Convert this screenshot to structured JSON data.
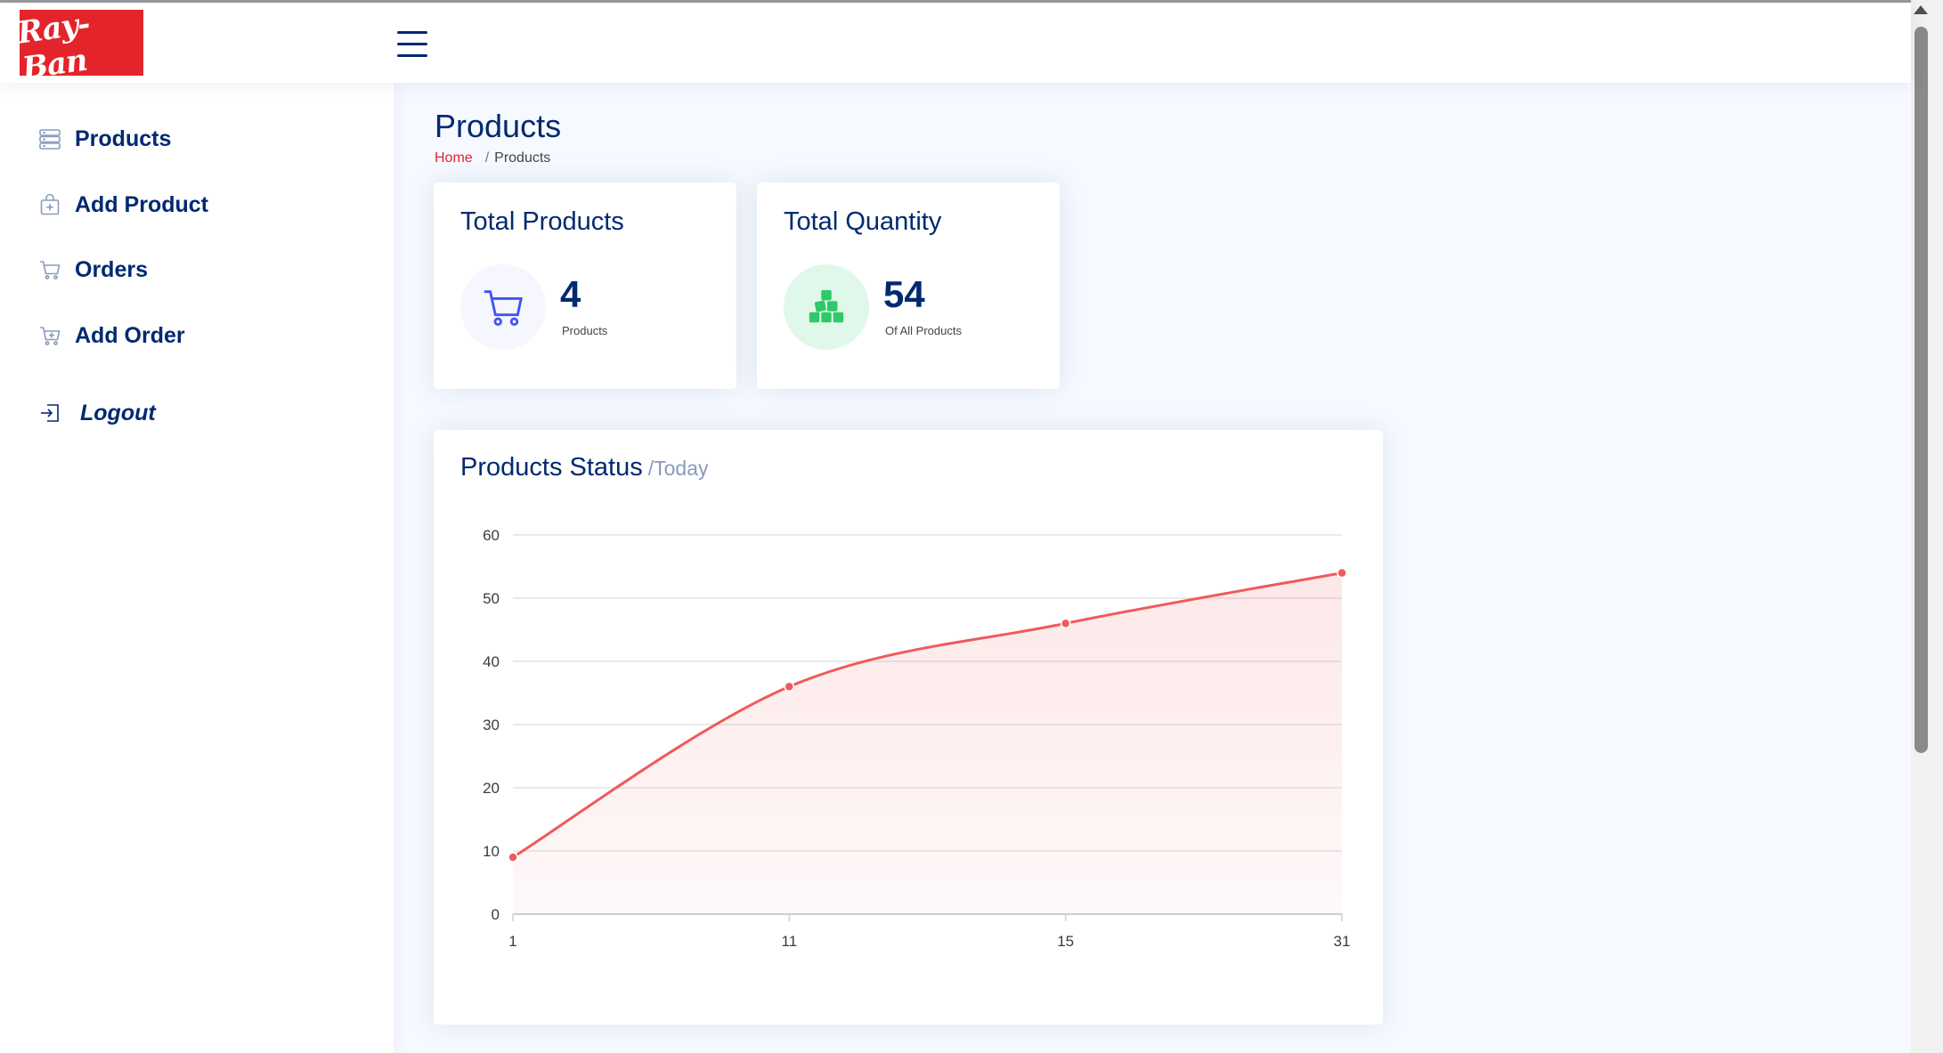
{
  "header": {
    "logo_text": "Ray-Ban",
    "menu_icon": "hamburger-icon"
  },
  "sidebar": {
    "items": [
      {
        "label": "Products",
        "icon": "products-list-icon"
      },
      {
        "label": "Add Product",
        "icon": "add-bag-icon"
      },
      {
        "label": "Orders",
        "icon": "cart-icon"
      },
      {
        "label": "Add Order",
        "icon": "add-cart-icon"
      },
      {
        "label": "Logout",
        "icon": "logout-icon"
      }
    ]
  },
  "page": {
    "title": "Products",
    "breadcrumb": {
      "home": "Home",
      "separator": "/",
      "current": "Products"
    }
  },
  "cards": {
    "total_products": {
      "title": "Total Products",
      "value": "4",
      "label": "Products",
      "icon": "cart-icon"
    },
    "total_quantity": {
      "title": "Total Quantity",
      "value": "54",
      "label": "Of All Products",
      "icon": "boxes-icon"
    }
  },
  "chart": {
    "title": "Products Status",
    "subtitle": "/Today"
  },
  "colors": {
    "accent": "#e3242b",
    "navy": "#012970",
    "line": "#f05a5a",
    "cart_bg": "#f6f6fe",
    "cart_icon": "#4154f1",
    "boxes_bg": "#e0f8e9",
    "boxes_icon": "#2eca6a"
  },
  "chart_data": {
    "type": "area",
    "title": "",
    "xlabel": "",
    "ylabel": "",
    "x": [
      "1",
      "11",
      "15",
      "31"
    ],
    "series": [
      {
        "values": [
          9,
          36,
          46,
          54
        ]
      }
    ],
    "ylim": [
      0,
      60
    ],
    "yticks": [
      0,
      10,
      20,
      30,
      40,
      50,
      60
    ],
    "grid": true,
    "legend": "none"
  }
}
